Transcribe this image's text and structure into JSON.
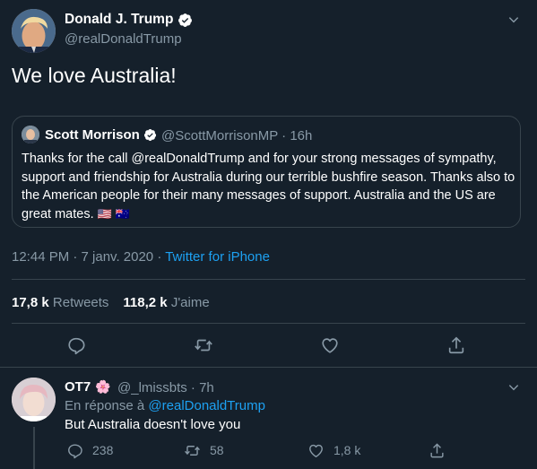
{
  "main": {
    "name": "Donald J. Trump",
    "handle": "@realDonaldTrump",
    "text": "We love Australia!",
    "timestamp": "12:44 PM · 7 janv. 2020 · ",
    "source": "Twitter for iPhone",
    "retweets_count": "17,8 k",
    "retweets_label": "Retweets",
    "likes_count": "118,2 k",
    "likes_label": "J'aime"
  },
  "quote": {
    "name": "Scott Morrison",
    "meta": "@ScottMorrisonMP · 16h",
    "text": "Thanks for the call @realDonaldTrump and for your strong messages of sympathy, support and friendship for Australia during our terrible bushfire season. Thanks also to the American people for their many messages of support. Australia and the US are great mates.",
    "flag_us": "🇺🇸",
    "flag_au": "🇦🇺"
  },
  "reply": {
    "name": "OT7",
    "emoji": "🌸",
    "meta": "@_lmissbts · 7h",
    "reply_prefix": "En réponse à ",
    "reply_to": "@realDonaldTrump",
    "text": "But Australia doesn't love you",
    "reply_count": "238",
    "retweet_count": "58",
    "like_count": "1,8 k"
  },
  "colors": {
    "background": "#15202b",
    "border": "#38444d",
    "muted": "#8899a6",
    "accent": "#1da1f2"
  },
  "icons": [
    "verified-badge-icon",
    "chevron-down-icon",
    "reply-icon",
    "retweet-icon",
    "like-icon",
    "share-icon"
  ]
}
